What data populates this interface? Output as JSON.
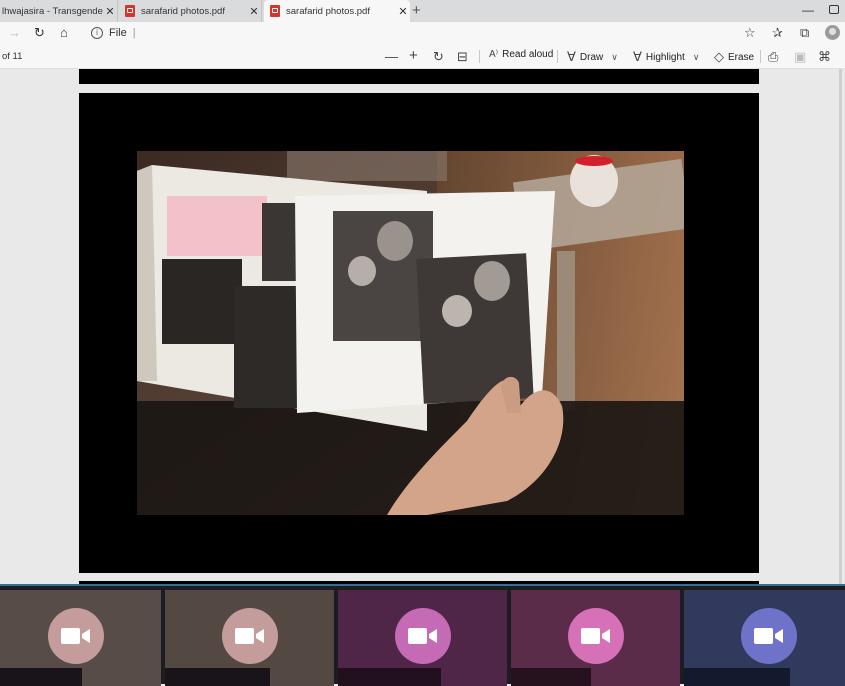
{
  "tabs": [
    {
      "title": "lhwajasira - Transgender in Paris",
      "close": "✕",
      "active": false
    },
    {
      "title": "sarafarid photos.pdf",
      "close": "✕",
      "active": false
    },
    {
      "title": "sarafarid photos.pdf",
      "close": "✕",
      "active": true
    }
  ],
  "new_tab": "+",
  "window": {
    "minimize": "—"
  },
  "nav": {
    "back": "→",
    "refresh": "↻",
    "home": "⌂"
  },
  "address": {
    "scheme": "File",
    "info_icon": "i",
    "separator": "|"
  },
  "toolbar_right": {
    "favorite": "☆",
    "favorites": "✰",
    "collections": "⧉"
  },
  "pdf_toolbar": {
    "page_count": "of 11",
    "zoom_out": "—",
    "zoom_in": "+",
    "rotate": "↻",
    "fit": "⊟",
    "read_aloud": "Read aloud",
    "read_aloud_icon": "A⁾",
    "draw": "Draw",
    "draw_icon": "∀",
    "highlight": "Highlight",
    "highlight_icon": "∀",
    "erase": "Erase",
    "erase_icon": "◇",
    "chevron": "∨",
    "print": "⎙",
    "save": "▣",
    "save_as": "⌘"
  },
  "colors": {
    "tile1_bg": "#574c47",
    "tile1_cam": "#c59c9c",
    "tile2_bg": "#544843",
    "tile2_cam": "#c59c9c",
    "tile3_bg": "#4f2647",
    "tile3_cam": "#c56bb5",
    "tile4_bg": "#5b2b4a",
    "tile4_cam": "#d670b7",
    "tile5_bg": "#313a5d",
    "tile5_cam": "#6e73c9"
  }
}
